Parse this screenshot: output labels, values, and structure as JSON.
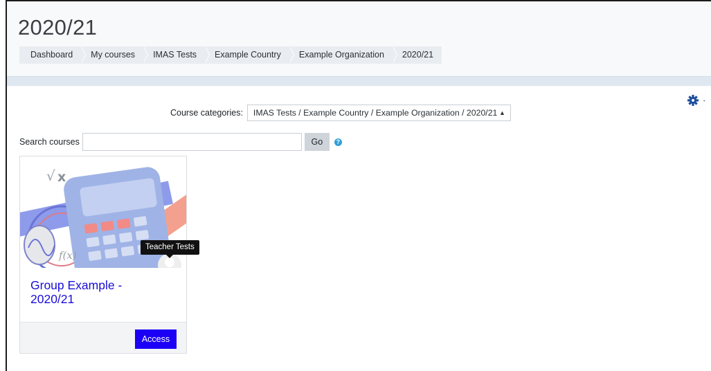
{
  "page": {
    "title": "2020/21"
  },
  "breadcrumb": [
    {
      "label": "Dashboard"
    },
    {
      "label": "My courses"
    },
    {
      "label": "IMAS Tests"
    },
    {
      "label": "Example Country"
    },
    {
      "label": "Example Organization"
    },
    {
      "label": "2020/21"
    }
  ],
  "settings": {
    "icon": "gear-icon"
  },
  "categories": {
    "label": "Course categories:",
    "selected": "IMAS Tests / Example Country / Example Organization / 2020/21"
  },
  "search": {
    "label": "Search courses",
    "value": "",
    "button_label": "Go",
    "help_icon": "question-circle-icon"
  },
  "course_card": {
    "title": "Group Example - 2020/21",
    "image_icon": "math-calculator-illustration",
    "tooltip": "Teacher Tests",
    "access_label": "Access"
  },
  "colors": {
    "link": "#1a0dd8",
    "primary_button": "#1c00f6",
    "help": "#2f9fd6",
    "gear": "#1e4e9c"
  }
}
